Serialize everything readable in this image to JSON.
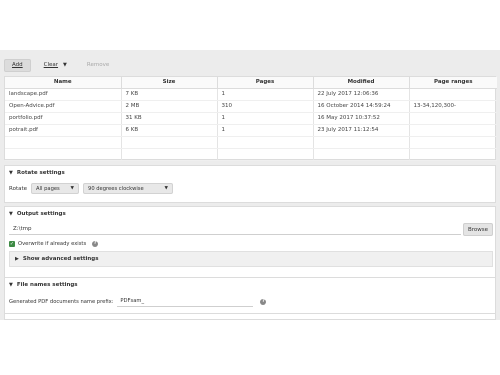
{
  "toolbar": {
    "add": "Add",
    "clear": "Clear",
    "remove": "Remove"
  },
  "table": {
    "headers": [
      "Name",
      "Size",
      "Pages",
      "Modified",
      "Page ranges"
    ],
    "rows": [
      [
        "landscape.pdf",
        "7 KB",
        "1",
        "22 July 2017 12:06:36",
        ""
      ],
      [
        "Open-Advice.pdf",
        "2 MB",
        "310",
        "16 October 2014 14:59:24",
        "13-34,120,300-"
      ],
      [
        "portfolio.pdf",
        "31 KB",
        "1",
        "16 May 2017 10:37:52",
        ""
      ],
      [
        "potrait.pdf",
        "6 KB",
        "1",
        "23 July 2017 11:12:54",
        ""
      ]
    ]
  },
  "rotate": {
    "title": "Rotate settings",
    "label": "Rotate",
    "pages_value": "All pages",
    "degrees_value": "90 degrees clockwise"
  },
  "output": {
    "title": "Output settings",
    "path": "Z:\\tmp",
    "browse": "Browse",
    "overwrite_label": "Overwrite if already exists",
    "overwrite_checked": true,
    "advanced": "Show advanced settings"
  },
  "file_names": {
    "title": "File names settings",
    "prefix_label": "Generated PDF documents name prefix:",
    "prefix_value": "PDFsam_"
  }
}
